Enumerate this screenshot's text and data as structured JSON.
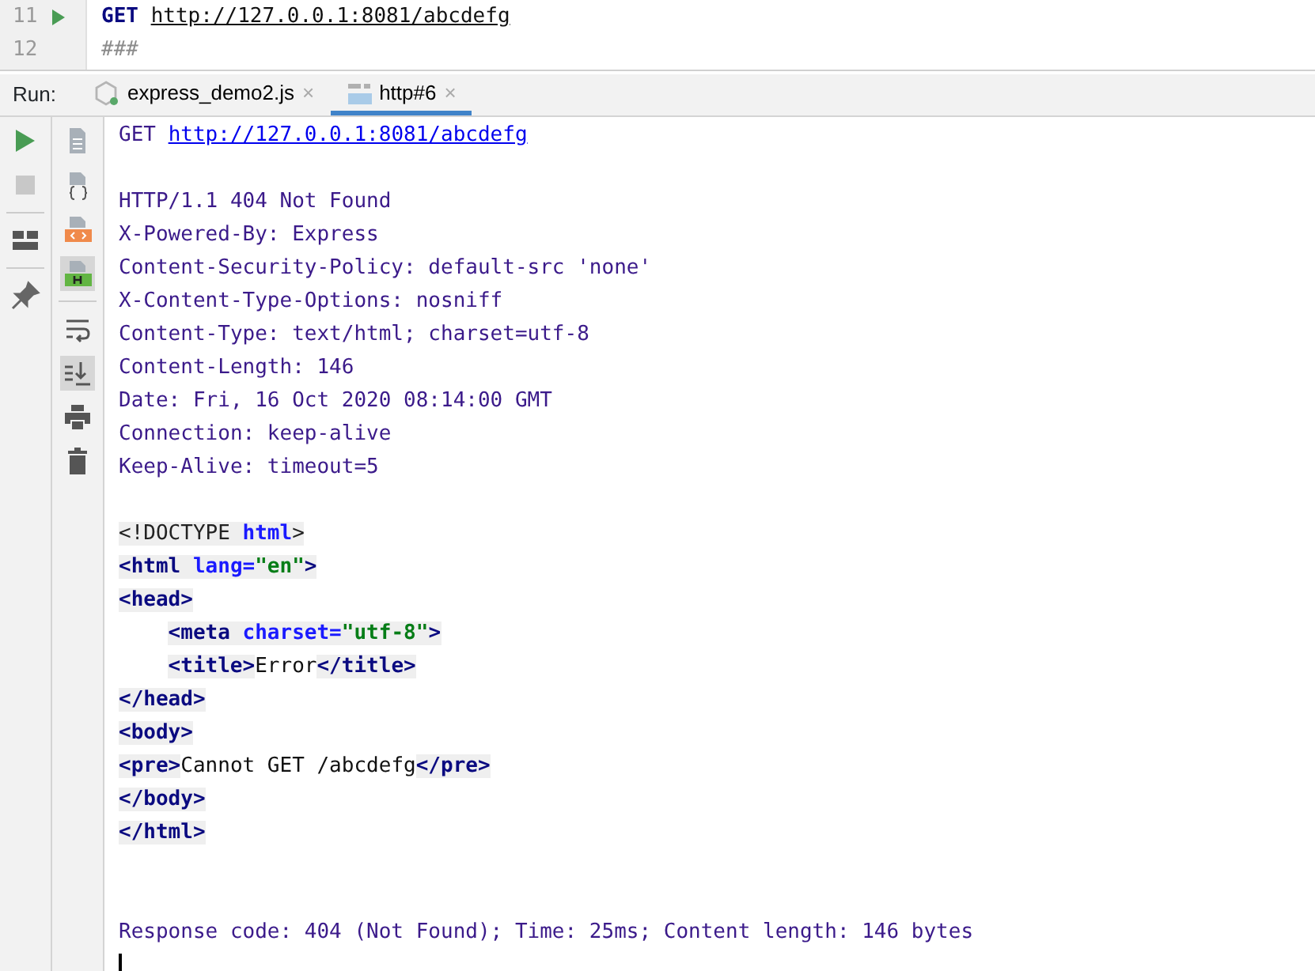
{
  "editor": {
    "lines": [
      {
        "number": "11",
        "runnable": true,
        "method": "GET",
        "url": "http://127.0.0.1:8081/abcdefg"
      },
      {
        "number": "12",
        "runnable": false,
        "comment": "###"
      }
    ]
  },
  "run_panel": {
    "label": "Run:",
    "tabs": [
      {
        "label": "express_demo2.js",
        "kind": "node",
        "selected": false,
        "close": "×"
      },
      {
        "label": "http#6",
        "kind": "api",
        "selected": true,
        "close": "×"
      }
    ],
    "toolbar_left": [
      {
        "kind": "run",
        "disabled": false
      },
      {
        "kind": "stop",
        "disabled": true
      },
      {
        "kind": "sep"
      },
      {
        "kind": "layout",
        "disabled": false
      },
      {
        "kind": "sep"
      },
      {
        "kind": "pin",
        "disabled": false
      }
    ],
    "toolbar_right": [
      {
        "kind": "doc",
        "active": false
      },
      {
        "kind": "doc-json",
        "active": false
      },
      {
        "kind": "doc-html",
        "active": false
      },
      {
        "kind": "doc-h",
        "active": true
      },
      {
        "kind": "sep"
      },
      {
        "kind": "wrap",
        "active": false
      },
      {
        "kind": "scroll-end",
        "active": true
      },
      {
        "kind": "print",
        "active": false
      },
      {
        "kind": "trash",
        "active": false
      }
    ],
    "request": {
      "method": "GET",
      "url": "http://127.0.0.1:8081/abcdefg"
    },
    "headers": [
      "HTTP/1.1 404 Not Found",
      "X-Powered-By: Express",
      "Content-Security-Policy: default-src 'none'",
      "X-Content-Type-Options: nosniff",
      "Content-Type: text/html; charset=utf-8",
      "Content-Length: 146",
      "Date: Fri, 16 Oct 2020 08:14:00 GMT",
      "Connection: keep-alive",
      "Keep-Alive: timeout=5"
    ],
    "body": [
      [
        {
          "kind": "bracket",
          "text": "<!DOCTYPE "
        },
        {
          "kind": "attr",
          "text": "html"
        },
        {
          "kind": "bracket",
          "text": ">"
        }
      ],
      [
        {
          "kind": "tag",
          "text": "<html "
        },
        {
          "kind": "attr",
          "text": "lang="
        },
        {
          "kind": "value",
          "text": "\"en\""
        },
        {
          "kind": "tag",
          "text": ">"
        }
      ],
      [
        {
          "kind": "tag",
          "text": "<head>"
        }
      ],
      [
        {
          "kind": "indent"
        },
        {
          "kind": "tag",
          "text": "<meta "
        },
        {
          "kind": "attr",
          "text": "charset="
        },
        {
          "kind": "value",
          "text": "\"utf-8\""
        },
        {
          "kind": "tag",
          "text": ">"
        }
      ],
      [
        {
          "kind": "indent"
        },
        {
          "kind": "tag",
          "text": "<title>"
        },
        {
          "kind": "text",
          "text": "Error"
        },
        {
          "kind": "tag",
          "text": "</title>"
        }
      ],
      [
        {
          "kind": "tag",
          "text": "</head>"
        }
      ],
      [
        {
          "kind": "tag",
          "text": "<body>"
        }
      ],
      [
        {
          "kind": "tag",
          "text": "<pre>"
        },
        {
          "kind": "text",
          "text": "Cannot GET /abcdefg"
        },
        {
          "kind": "tag",
          "text": "</pre>"
        }
      ],
      [
        {
          "kind": "tag",
          "text": "</body>"
        }
      ],
      [
        {
          "kind": "tag",
          "text": "</html>"
        }
      ]
    ],
    "footer": "Response code: 404 (Not Found); Time: 25ms; Content length: 146 bytes",
    "cursor": true
  }
}
